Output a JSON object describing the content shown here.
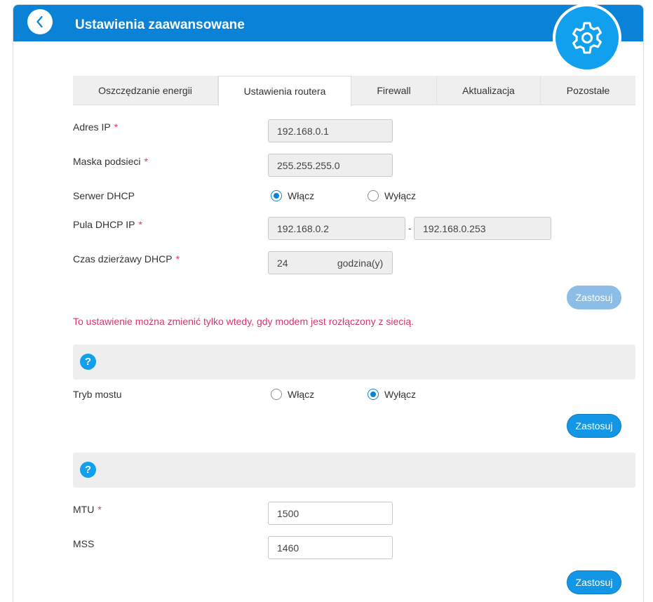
{
  "header": {
    "title": "Ustawienia zaawansowane"
  },
  "tabs": [
    {
      "label": "Oszczędzanie energii",
      "active": false
    },
    {
      "label": "Ustawienia routera",
      "active": true
    },
    {
      "label": "Firewall",
      "active": false
    },
    {
      "label": "Aktualizacja",
      "active": false
    },
    {
      "label": "Pozostałe",
      "active": false
    }
  ],
  "router": {
    "ip_label": "Adres IP",
    "ip_value": "192.168.0.1",
    "mask_label": "Maska podsieci",
    "mask_value": "255.255.255.0",
    "dhcp_label": "Serwer DHCP",
    "dhcp_on_label": "Włącz",
    "dhcp_off_label": "Wyłącz",
    "dhcp_selected": "on",
    "pool_label": "Pula DHCP IP",
    "pool_start": "192.168.0.2",
    "pool_separator": "-",
    "pool_end": "192.168.0.253",
    "lease_label": "Czas dzierżawy DHCP",
    "lease_value": "24",
    "lease_unit": "godzina(y)",
    "required_mark": "*",
    "apply_label": "Zastosuj",
    "apply_enabled": false,
    "note": "To ustawienie można zmienić tylko wtedy, gdy modem jest rozłączony z siecią."
  },
  "bridge": {
    "help_symbol": "?",
    "label": "Tryb mostu",
    "on_label": "Włącz",
    "off_label": "Wyłącz",
    "selected": "off",
    "apply_label": "Zastosuj"
  },
  "mtu": {
    "help_symbol": "?",
    "mtu_label": "MTU",
    "mtu_value": "1500",
    "mss_label": "MSS",
    "mss_value": "1460",
    "apply_label": "Zastosuj"
  },
  "colors": {
    "header_blue": "#0a82d8",
    "accent_blue": "#1496e6",
    "required_red": "#e0366a",
    "note_red": "#d8366c"
  }
}
